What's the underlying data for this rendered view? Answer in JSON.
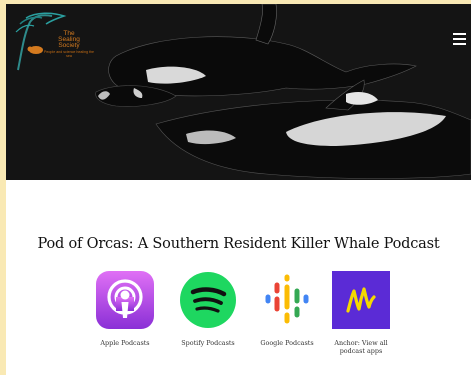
{
  "logo": {
    "line1": "The",
    "line2": "Sealing",
    "line3": "Society",
    "tagline": "People and science healing the sea"
  },
  "icons": {
    "menu": "hamburger-menu-icon",
    "apple": "apple-podcasts-icon",
    "spotify": "spotify-icon",
    "google": "google-podcasts-icon",
    "anchor": "anchor-icon"
  },
  "colors": {
    "page_background": "#f9e9b4",
    "hero_background": "#141414",
    "apple_gradient_top": "#e070f5",
    "apple_gradient_bottom": "#8a2fd6",
    "spotify": "#1ed760",
    "anchor": "#5b2bd6",
    "anchor_mark": "#f5d900"
  },
  "main": {
    "title": "Pod of Orcas: A Southern Resident Killer Whale Podcast",
    "apps": [
      {
        "label": "Apple Podcasts"
      },
      {
        "label": "Spotify Podcasts"
      },
      {
        "label": "Google Podcasts"
      },
      {
        "label": "Anchor: View all podcast apps"
      }
    ]
  }
}
